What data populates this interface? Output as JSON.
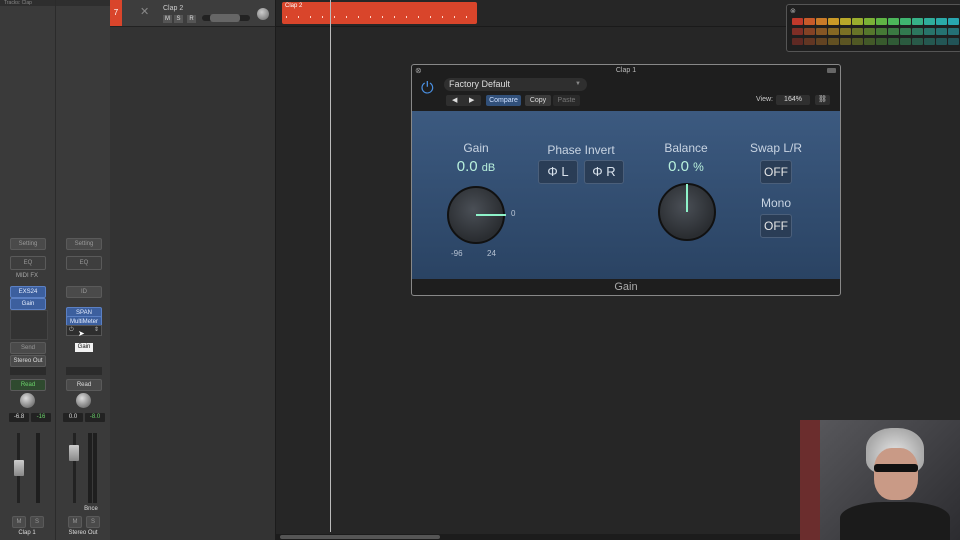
{
  "mixer": {
    "header_text": "Tracks: Clap",
    "strip1": {
      "setting": "Setting",
      "eq": "EQ",
      "midi_fx": "MIDI FX",
      "instrument": "EXS24",
      "insert1": "Gain",
      "send": "Send",
      "output": "Stereo Out",
      "automation": "Read",
      "volume": "-6.8",
      "peak": "-16",
      "mute": "M",
      "solo": "S",
      "name": "Clap 1"
    },
    "strip2": {
      "setting": "Setting",
      "eq": "EQ",
      "input": "ID",
      "insert1": "SPAN",
      "insert2": "MultiMeter",
      "tooltip": "Gain",
      "automation": "Read",
      "volume": "0.0",
      "peak": "-8.0",
      "bounce": "Bnce",
      "mute": "M",
      "solo": "S",
      "name": "Stereo Out"
    }
  },
  "track": {
    "number": "7",
    "name": "Clap 2",
    "mute": "M",
    "solo": "S",
    "record": "R"
  },
  "region": {
    "name": "Clap 2",
    "color": "#d9452b"
  },
  "plugin": {
    "title": "Clap 1",
    "preset": "Factory Default",
    "compare": "Compare",
    "copy": "Copy",
    "paste": "Paste",
    "view_label": "View:",
    "view_value": "164%",
    "footer": "Gain",
    "gain": {
      "label": "Gain",
      "value": "0.0",
      "unit": "dB",
      "min": "-96",
      "max": "24",
      "current": "0"
    },
    "phase_invert": {
      "label": "Phase Invert",
      "left": "L",
      "right": "R",
      "symbol": "Φ"
    },
    "balance": {
      "label": "Balance",
      "value": "0.0",
      "unit": "%"
    },
    "swap": {
      "label": "Swap L/R",
      "value": "OFF"
    },
    "mono": {
      "label": "Mono",
      "value": "OFF"
    }
  },
  "colors": {
    "accent": "#3c5f9e",
    "plugin_panel": "#34507a",
    "value_text": "#b8f0dc",
    "region": "#d9452b"
  }
}
